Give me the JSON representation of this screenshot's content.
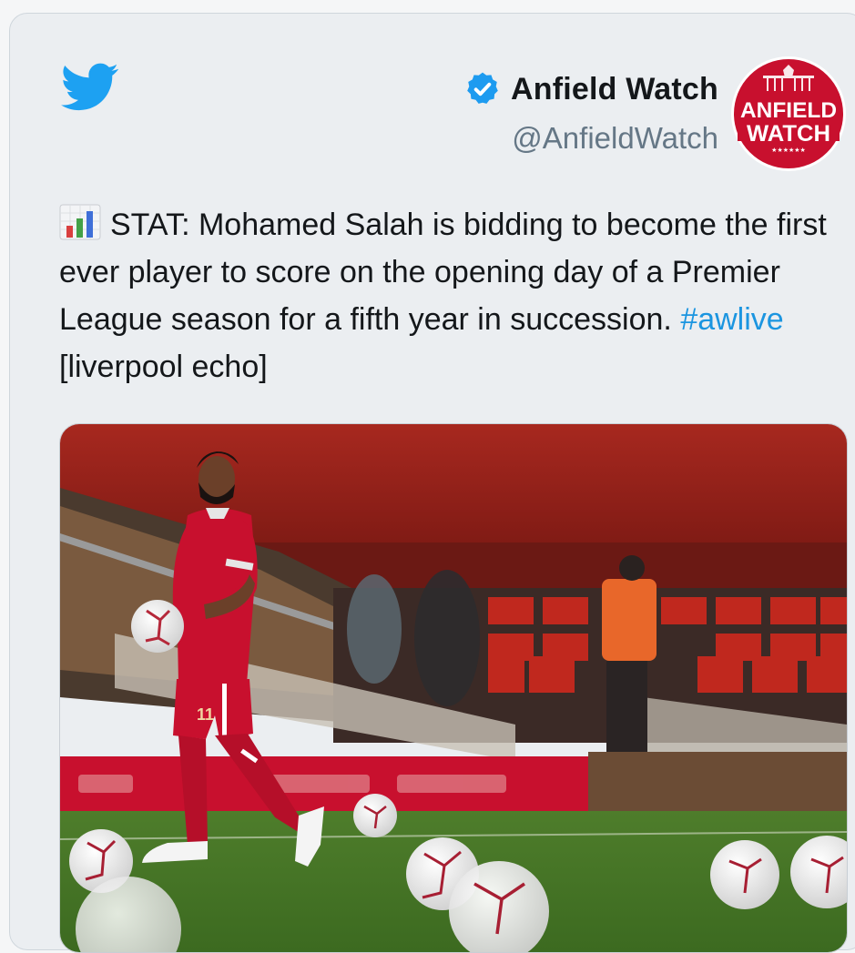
{
  "tweet": {
    "author_name": "Anfield Watch",
    "author_handle": "@AnfieldWatch",
    "avatar_lines": [
      "ANFIELD",
      "WATCH"
    ],
    "avatar_stars": "★★★★★★",
    "text_main": "STAT: Mohamed Salah is bidding to become the first ever player to score on the opening day of a Premier League season for a fifth year in succession.",
    "hashtag": "#awlive",
    "text_tail": "[liverpool echo]",
    "shirt_number": "11"
  },
  "icons": {
    "brand": "twitter-bird-icon",
    "verified": "verified-badge-icon",
    "stat": "bar-chart-icon"
  },
  "colors": {
    "twitter_blue": "#1da1f2",
    "verified_blue": "#1d9bf0",
    "hashtag": "#1b95e0",
    "avatar_red": "#c8102e",
    "kit_red": "#c8102e"
  }
}
